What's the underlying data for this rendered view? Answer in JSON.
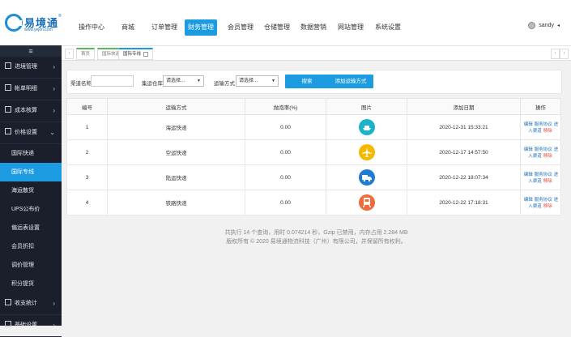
{
  "logo": {
    "name": "易境通",
    "url": "www.yejon.com",
    "reg": "®"
  },
  "nav": [
    {
      "label": "操作中心"
    },
    {
      "label": "商城"
    },
    {
      "label": "订单管理"
    },
    {
      "label": "财务管理"
    },
    {
      "label": "会员管理"
    },
    {
      "label": "仓储管理"
    },
    {
      "label": "数据营销"
    },
    {
      "label": "网站管理"
    },
    {
      "label": "系统设置"
    }
  ],
  "user": {
    "name": "sandy",
    "caret": "◂"
  },
  "sidebar": {
    "toggle": "≡",
    "items": [
      {
        "label": "进境管理",
        "arrow": "›"
      },
      {
        "label": "帐单明细",
        "arrow": "›"
      },
      {
        "label": "成本核算",
        "arrow": "›"
      },
      {
        "label": "价格设置",
        "arrow": "⌄"
      }
    ],
    "sub": [
      "国际快递",
      "国际专线",
      "海运散货",
      "UPS公布价",
      "偏远表设置",
      "会员折扣",
      "调价管理",
      "积分提货"
    ],
    "bottom": [
      {
        "label": "收支统计",
        "arrow": "›"
      },
      {
        "label": "基础设置",
        "arrow": "›"
      }
    ]
  },
  "tabs": {
    "prev": "‹",
    "next": "›",
    "items": [
      "首页",
      "国际快递",
      "国际专线"
    ]
  },
  "search": {
    "channel_label": "渠道名称",
    "channel_value": "",
    "warehouse_label": "集运仓库",
    "warehouse_value": "请选择...",
    "mode_label": "运输方式",
    "mode_value": "请选择...",
    "search_btn": "搜索",
    "add_btn": "添加运输方式"
  },
  "table": {
    "headers": [
      "编号",
      "运输方式",
      "抛泡率(%)",
      "图片",
      "添加日期",
      "操作"
    ],
    "rows": [
      {
        "id": "1",
        "mode": "海运快递",
        "rate": "0.00",
        "icon": "ship-icon",
        "color": "#1ab3c9",
        "date": "2020-12-31 15:33:21"
      },
      {
        "id": "2",
        "mode": "空运快递",
        "rate": "0.00",
        "icon": "airplane-icon",
        "color": "#f5b800",
        "date": "2020-12-17 14:57:50"
      },
      {
        "id": "3",
        "mode": "陆运快递",
        "rate": "0.00",
        "icon": "truck-icon",
        "color": "#1f7bd3",
        "date": "2020-12-22 18:07:34"
      },
      {
        "id": "4",
        "mode": "铁路快递",
        "rate": "0.00",
        "icon": "train-icon",
        "color": "#f06b3a",
        "date": "2020-12-22 17:18:31"
      }
    ],
    "ops": [
      "编辑",
      "服务协议",
      "进入渠道",
      "移除"
    ]
  },
  "footer": {
    "line1": "共执行 14 个查询，用时 0.074214 秒，Gzip 已禁用，内存占用 2.284 MB",
    "line2": "版权所有 © 2020 易境通物流科技（广州）有限公司，并保留所有权利。"
  }
}
